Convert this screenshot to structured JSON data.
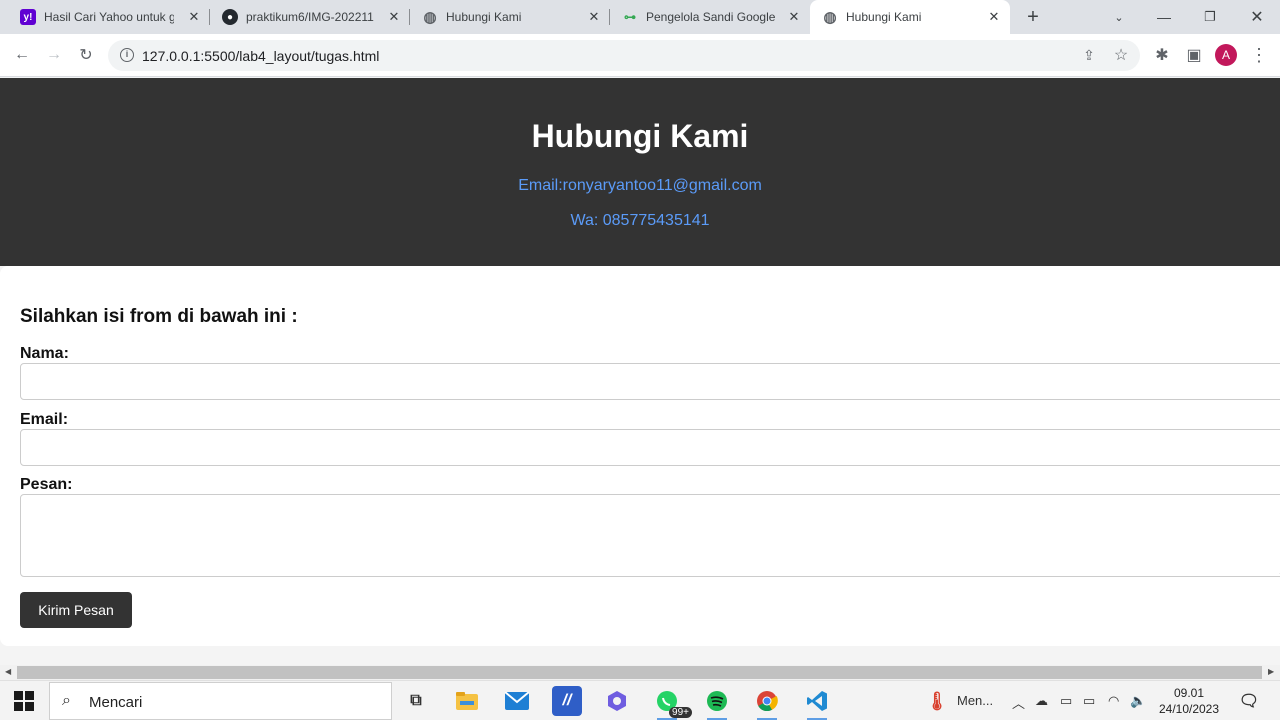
{
  "browser": {
    "tabs": [
      {
        "title": "Hasil Cari Yahoo untuk gi",
        "favicon": "yahoo-icon"
      },
      {
        "title": "praktikum6/IMG-202211",
        "favicon": "github-icon"
      },
      {
        "title": "Hubungi Kami",
        "favicon": "globe-icon"
      },
      {
        "title": "Pengelola Sandi Google",
        "favicon": "key-icon"
      },
      {
        "title": "Hubungi Kami",
        "favicon": "globe-icon",
        "active": true
      }
    ],
    "url": "127.0.0.1:5500/lab4_layout/tugas.html",
    "profile_initial": "A",
    "profile_color": "#c2185b"
  },
  "page": {
    "header": {
      "title": "Hubungi Kami",
      "email": "Email:ronyaryantoo11@gmail.com",
      "wa": "Wa: 085775435141",
      "bg_color": "#333333",
      "link_color": "#5b9bf8"
    },
    "form": {
      "heading": "Silahkan isi from di bawah ini :",
      "name_label": "Nama:",
      "name_value": "",
      "email_label": "Email:",
      "email_value": "",
      "message_label": "Pesan:",
      "message_value": "",
      "submit_label": "Kirim Pesan"
    }
  },
  "taskbar": {
    "search_placeholder": "Mencari",
    "apps": [
      "task-view-icon",
      "file-explorer-icon",
      "mail-icon",
      "code-editor-icon",
      "copilot-icon",
      "whatsapp-icon",
      "spotify-icon",
      "chrome-icon",
      "vscode-icon"
    ],
    "whatsapp_badge": "99+",
    "weather_text": "Men...",
    "time": "09.01",
    "date": "24/10/2023"
  }
}
